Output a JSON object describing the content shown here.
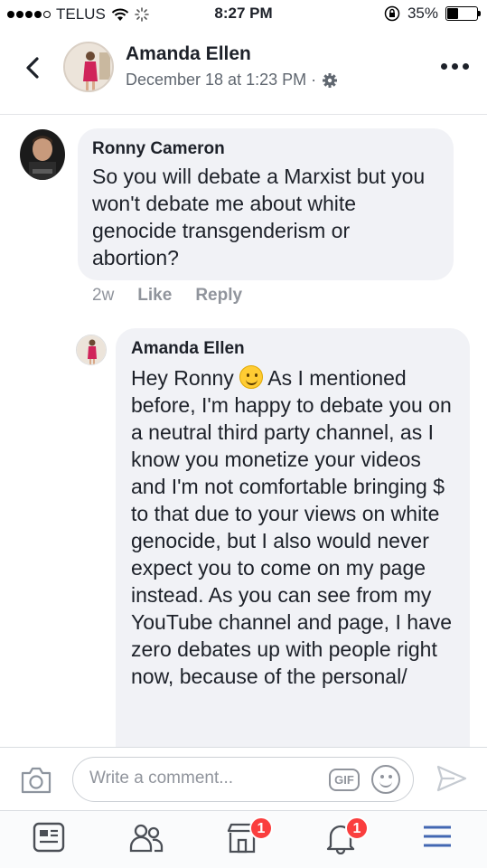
{
  "status_bar": {
    "carrier": "TELUS",
    "time": "8:27 PM",
    "battery": "35%",
    "battery_level": 0.35
  },
  "header": {
    "name": "Amanda Ellen",
    "meta": "December 18 at 1:23 PM ·"
  },
  "comments": [
    {
      "author": "Ronny Cameron",
      "text": "So you will debate a Marxist but you won't debate me about white genocide transgenderism or abortion?",
      "timestamp": "2w",
      "like": "Like",
      "reply": "Reply"
    },
    {
      "author": "Amanda Ellen",
      "text_before_emoji": "Hey Ronny",
      "text_after_emoji": "As I mentioned before, I'm happy to debate you on a neutral third party channel, as I know you monetize your videos and I'm not comfortable bringing $ to that due to your views on white genocide, but I also would never expect you to come on my page instead. As you can see from my YouTube channel and page, I have zero debates up with people right now, because of the personal/"
    }
  ],
  "composer": {
    "placeholder": "Write a comment...",
    "gif_label": "GIF"
  },
  "tabbar": {
    "marketplace_badge": "1",
    "notifications_badge": "1"
  },
  "colors": {
    "accent": "#4267b2",
    "badge": "#fa3e3e",
    "bubble": "#f1f2f6"
  }
}
